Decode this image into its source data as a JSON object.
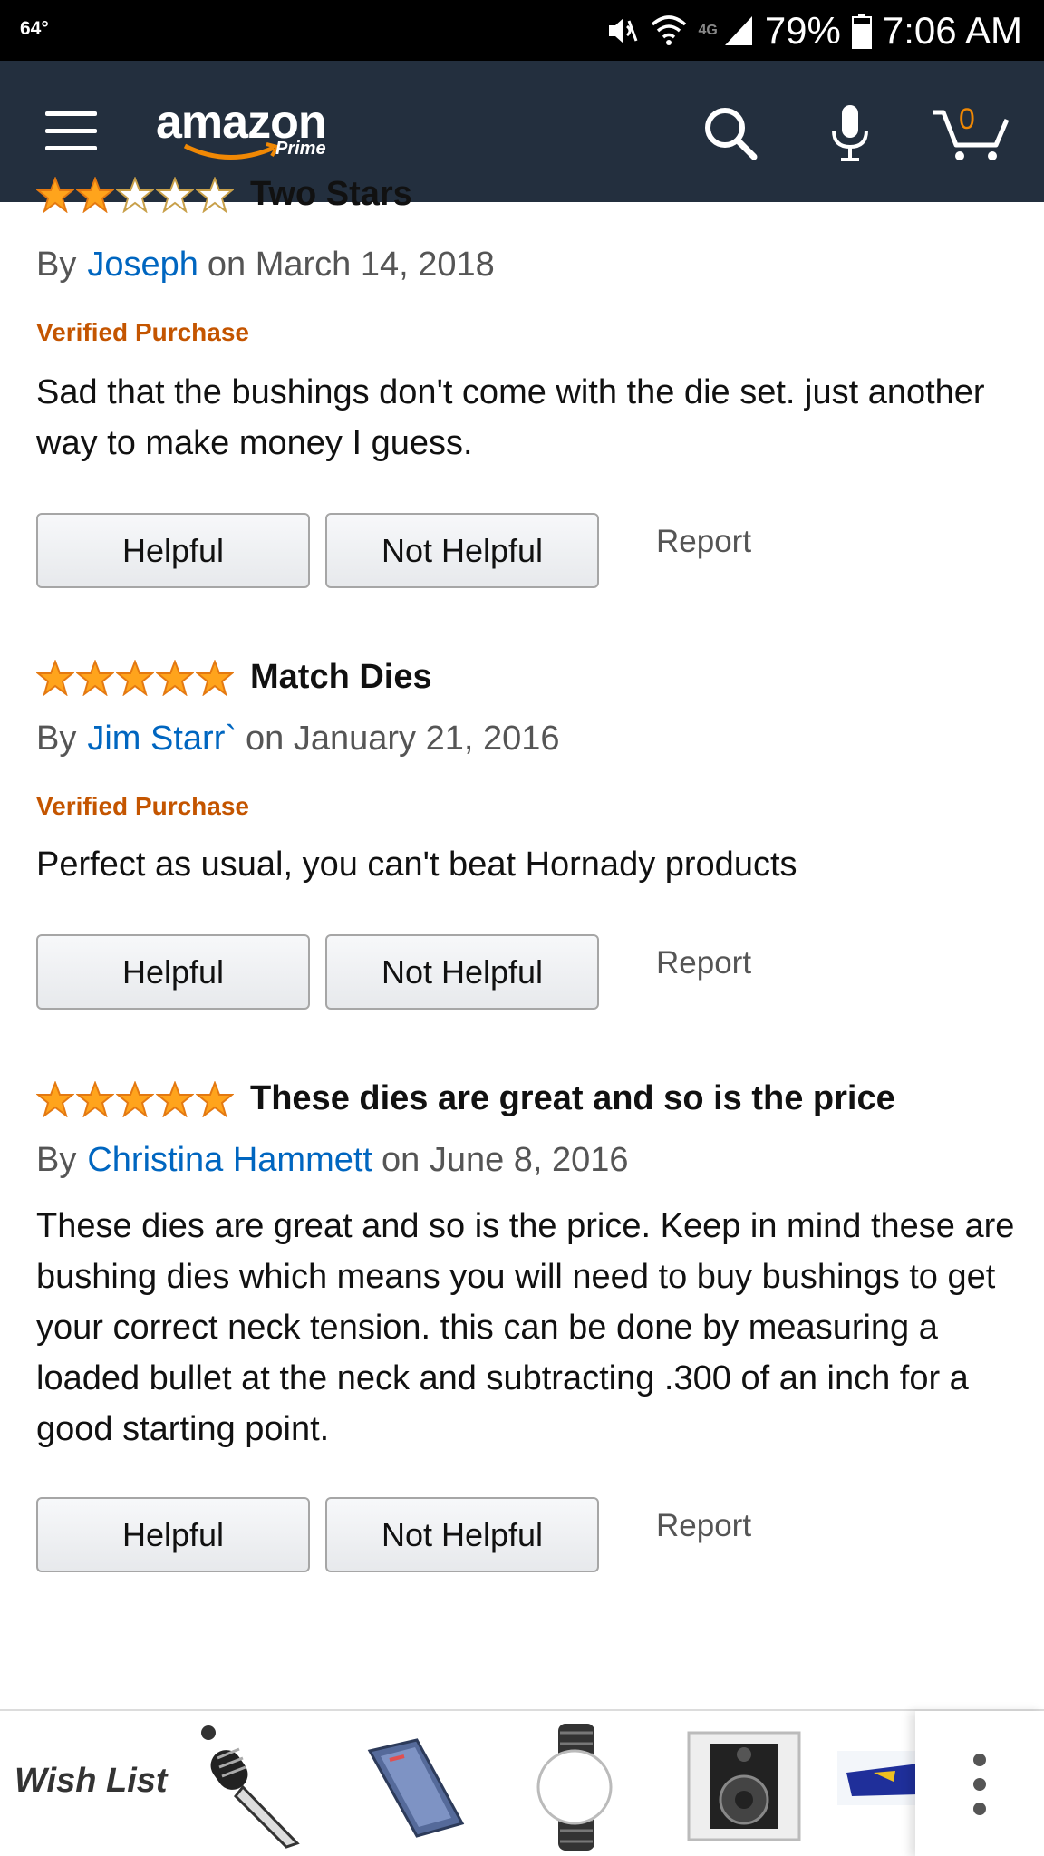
{
  "status_bar": {
    "temperature": "64°",
    "network": "4G",
    "battery": "79%",
    "time": "7:06 AM"
  },
  "header": {
    "logo_text": "amazon",
    "logo_sub": "Prime",
    "cart_count": "0",
    "icons": [
      "menu-icon",
      "search-icon",
      "microphone-icon",
      "cart-icon"
    ],
    "colors": {
      "background": "#232f3e",
      "accent": "#f08804"
    }
  },
  "reviews": [
    {
      "rating": 2,
      "title": "Two Stars",
      "by_label": "By",
      "author": "Joseph",
      "date": "on March 14, 2018",
      "verified": "Verified Purchase",
      "body": "Sad that the bushings don't come with the die set. just another way to make money I guess.",
      "helpful": "Helpful",
      "not_helpful": "Not Helpful",
      "report": "Report"
    },
    {
      "rating": 5,
      "title": "Match Dies",
      "by_label": "By",
      "author": "Jim Starr`",
      "date": "on January 21, 2016",
      "verified": "Verified Purchase",
      "body": "Perfect as usual, you can't beat Hornady products",
      "helpful": "Helpful",
      "not_helpful": "Not Helpful",
      "report": "Report"
    },
    {
      "rating": 5,
      "title": "These dies are great and so is the price",
      "by_label": "By",
      "author": "Christina Hammett",
      "date": "on June 8, 2016",
      "body": "These dies are great and so is the price. Keep in mind these are bushing dies which means you will need to buy bushings to get your correct neck tension. this can be done by measuring a loaded bullet at the neck and subtracting .300 of an inch for a good starting point.",
      "helpful": "Helpful",
      "not_helpful": "Not Helpful",
      "report": "Report"
    }
  ],
  "wish_list": {
    "label": "Wish List",
    "items": [
      "knife-item",
      "laptop-item",
      "watch-band-item",
      "speaker-item",
      "blue-device-item"
    ],
    "more_icon": "more-vertical-icon"
  },
  "colors": {
    "link": "#0066c0",
    "verified": "#c45500",
    "star": "#ffa41c"
  }
}
